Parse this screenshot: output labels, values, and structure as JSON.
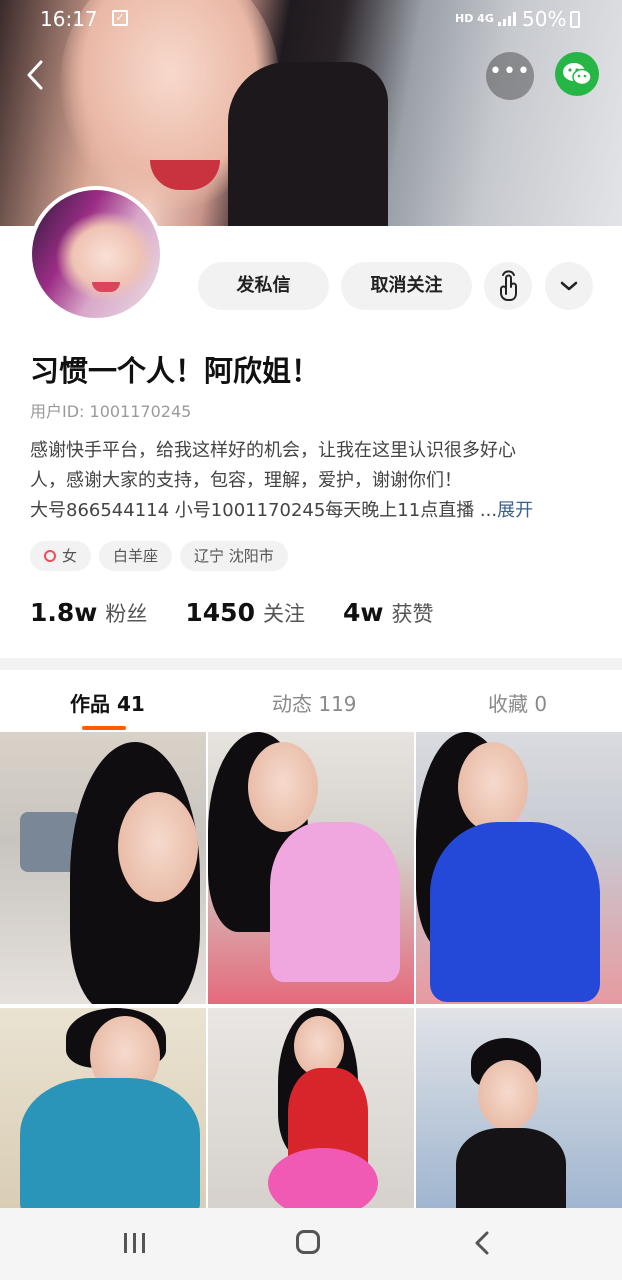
{
  "status_bar": {
    "time": "16:17",
    "network": "HD 4G",
    "battery": "50%"
  },
  "profile": {
    "nickname": "习惯一个人！阿欣姐！",
    "user_id": "用户ID: 1001170245",
    "bio_line1": "感谢快手平台，给我这样好的机会，让我在这里认识很多好心",
    "bio_line2": "人，感谢大家的支持，包容，理解，爱护，谢谢你们！",
    "bio_line3": "大号866544114 小号1001170245每天晚上11点直播 ...",
    "bio_expand": "展开",
    "tags": [
      "女",
      "白羊座",
      "辽宁 沈阳市"
    ]
  },
  "actions": {
    "message_label": "发私信",
    "unfollow_label": "取消关注"
  },
  "stats": [
    {
      "value": "1.8w",
      "label": "粉丝"
    },
    {
      "value": "1450",
      "label": "关注"
    },
    {
      "value": "4w",
      "label": "获赞"
    }
  ],
  "tabs": [
    {
      "label": "作品 41",
      "active": true
    },
    {
      "label": "动态 119",
      "active": false
    },
    {
      "label": "收藏 0",
      "active": false
    }
  ],
  "colors": {
    "accent": "#ff5b00",
    "wechat": "#26b645",
    "link": "#3a5f8f"
  },
  "icons": [
    "back-icon",
    "more-icon",
    "wechat-icon",
    "touch-icon",
    "chevron-down-icon",
    "gender-female-icon",
    "nav-recent-icon",
    "nav-home-icon",
    "nav-back-icon"
  ]
}
